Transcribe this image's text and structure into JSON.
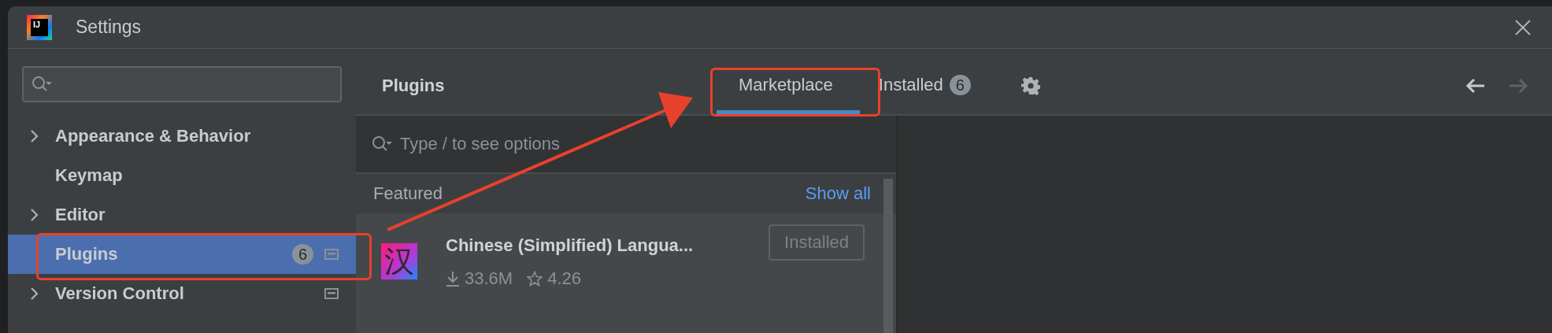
{
  "window": {
    "title": "Settings",
    "app_icon_text": "IJ"
  },
  "sidebar": {
    "items": [
      {
        "label": "Appearance & Behavior",
        "kind": "group",
        "selected": false,
        "pinned": false
      },
      {
        "label": "Keymap",
        "kind": "leaf",
        "selected": false,
        "pinned": false
      },
      {
        "label": "Editor",
        "kind": "group",
        "selected": false,
        "pinned": false
      },
      {
        "label": "Plugins",
        "kind": "leaf",
        "selected": true,
        "badge": "6",
        "pinned": true
      },
      {
        "label": "Version Control",
        "kind": "group",
        "selected": false,
        "pinned": true
      }
    ]
  },
  "plugins": {
    "title": "Plugins",
    "tabs": [
      {
        "label": "Marketplace",
        "selected": true
      },
      {
        "label": "Installed",
        "selected": false,
        "badge": "6"
      }
    ],
    "navigation": {
      "back_disabled": false,
      "forward_disabled": true
    },
    "search": {
      "placeholder": "Type / to see options"
    },
    "section": {
      "title": "Featured",
      "link": "Show all"
    },
    "items": [
      {
        "name": "Chinese (Simplified) Langua...",
        "icon_text": "汉",
        "downloads": "33.6M",
        "rating": "4.26",
        "button": "Installed"
      }
    ]
  }
}
